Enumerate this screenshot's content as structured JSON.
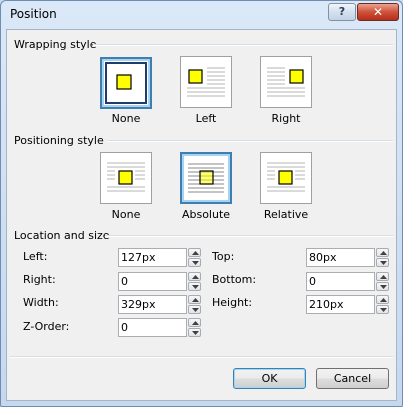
{
  "window": {
    "title": "Position",
    "help_label": "?",
    "close_label": "✕"
  },
  "wrapping": {
    "title": "Wrapping style",
    "options": [
      {
        "label": "None",
        "selected": true
      },
      {
        "label": "Left",
        "selected": false
      },
      {
        "label": "Right",
        "selected": false
      }
    ]
  },
  "positioning": {
    "title": "Positioning style",
    "options": [
      {
        "label": "None",
        "selected": false
      },
      {
        "label": "Absolute",
        "selected": true
      },
      {
        "label": "Relative",
        "selected": false
      }
    ]
  },
  "location": {
    "title": "Location and size",
    "left": {
      "label": "Left:",
      "value": "127px"
    },
    "right": {
      "label": "Right:",
      "value": "0"
    },
    "width": {
      "label": "Width:",
      "value": "329px"
    },
    "zorder": {
      "label": "Z-Order:",
      "value": "0"
    },
    "top": {
      "label": "Top:",
      "value": "80px"
    },
    "bottom": {
      "label": "Bottom:",
      "value": "0"
    },
    "height": {
      "label": "Height:",
      "value": "210px"
    }
  },
  "buttons": {
    "ok": "OK",
    "cancel": "Cancel"
  },
  "colors": {
    "accent": "#3c7fb1",
    "square_fill": "#ffff00"
  }
}
